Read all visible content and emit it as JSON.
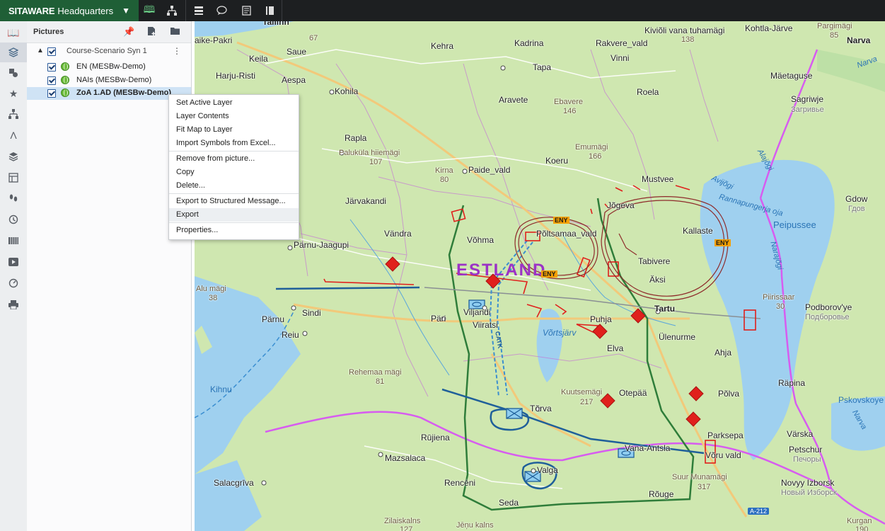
{
  "app": {
    "brand_bold": "SITAWARE",
    "brand_rest": "Headquarters",
    "dropdown": "⌄"
  },
  "panel": {
    "title": "Pictures",
    "picture": "Course-Scenario Syn 1",
    "layers": [
      {
        "label": "EN (MESBw-Demo)",
        "checked": true,
        "selected": false
      },
      {
        "label": "NAIs (MESBw-Demo)",
        "checked": true,
        "selected": false
      },
      {
        "label": "ZoA 1.AD (MESBw-Demo)",
        "checked": true,
        "selected": true
      }
    ]
  },
  "context_menu": {
    "groups": [
      [
        "Set Active Layer",
        "Layer Contents",
        "Fit Map to Layer",
        "Import Symbols from Excel..."
      ],
      [
        "Remove from picture...",
        "Copy",
        "Delete..."
      ],
      [
        "Export to Structured Message...",
        "Export"
      ],
      [
        "Properties..."
      ]
    ],
    "hovered": "Export"
  },
  "map": {
    "country": "ESTLAND",
    "places": [
      {
        "t": "Tallinn"
      },
      {
        "t": "Kiviõli vana tuhamägi"
      },
      {
        "t": "138"
      },
      {
        "t": "Kohtla-Järve"
      },
      {
        "t": "Pargimägi"
      },
      {
        "t": "85"
      },
      {
        "t": "Narva"
      },
      {
        "t": "aike-Pakri"
      },
      {
        "t": "67"
      },
      {
        "t": "Kehra"
      },
      {
        "t": "Kadrina"
      },
      {
        "t": "Rakvere_vald"
      },
      {
        "t": "Keila"
      },
      {
        "t": "Saue"
      },
      {
        "t": "Vinni"
      },
      {
        "t": "Harju-Risti"
      },
      {
        "t": "Tapa"
      },
      {
        "t": "Mäetaguse"
      },
      {
        "t": "Aespa"
      },
      {
        "t": "Kohila"
      },
      {
        "t": "Roela"
      },
      {
        "t": "Aravete"
      },
      {
        "t": "Ebavere"
      },
      {
        "t": "146"
      },
      {
        "t": "Sagriwje"
      },
      {
        "t": "Загривье"
      },
      {
        "t": "Rapla"
      },
      {
        "t": "Paluküla hiiemägi"
      },
      {
        "t": "107"
      },
      {
        "t": "Emumägi"
      },
      {
        "t": "166"
      },
      {
        "t": "Koeru"
      },
      {
        "t": "rjamaa"
      },
      {
        "t": "Kirna"
      },
      {
        "t": "80"
      },
      {
        "t": "Paide_vald"
      },
      {
        "t": "Mustvee"
      },
      {
        "t": "Järvakandi"
      },
      {
        "t": "Jõgeva"
      },
      {
        "t": "Gdow"
      },
      {
        "t": "Гдов"
      },
      {
        "t": "Vändra"
      },
      {
        "t": "Võhma"
      },
      {
        "t": "Põltsamaa_vald"
      },
      {
        "t": "Kallaste"
      },
      {
        "t": "Peipussee"
      },
      {
        "t": "Pärnu-Jaagupi"
      },
      {
        "t": "Tabivere"
      },
      {
        "t": "Äksi"
      },
      {
        "t": "Alu mägi"
      },
      {
        "t": "38"
      },
      {
        "t": "Piirissaar"
      },
      {
        "t": "30"
      },
      {
        "t": "Podborov'ye"
      },
      {
        "t": "Подборовье"
      },
      {
        "t": "Viljandi"
      },
      {
        "t": "Tartu"
      },
      {
        "t": "Pärnu"
      },
      {
        "t": "Sindi"
      },
      {
        "t": "Päri"
      },
      {
        "t": "Viiratsi"
      },
      {
        "t": "Puhja"
      },
      {
        "t": "Reiu"
      },
      {
        "t": "Võrtsjärv"
      },
      {
        "t": "Ülenurme"
      },
      {
        "t": "Elva"
      },
      {
        "t": "Ahja"
      },
      {
        "t": "Rehemaa mägi"
      },
      {
        "t": "81"
      },
      {
        "t": "Kihnu"
      },
      {
        "t": "Räpina"
      },
      {
        "t": "Kuutsemägi"
      },
      {
        "t": "217"
      },
      {
        "t": "Otepää"
      },
      {
        "t": "Põlva"
      },
      {
        "t": "Tõrva"
      },
      {
        "t": "Pskovskoye"
      },
      {
        "t": "Rūjiena"
      },
      {
        "t": "Parksepa"
      },
      {
        "t": "Värska"
      },
      {
        "t": "Mazsalaca"
      },
      {
        "t": "Vana-Antsla"
      },
      {
        "t": "Võru vald"
      },
      {
        "t": "Petschur"
      },
      {
        "t": "Печоры"
      },
      {
        "t": "Valga"
      },
      {
        "t": "Salacgrīva"
      },
      {
        "t": "Rencēni"
      },
      {
        "t": "Suur Munamägi"
      },
      {
        "t": "317"
      },
      {
        "t": "Novyy Izborsk"
      },
      {
        "t": "Новый Изборск"
      },
      {
        "t": "Rõuge"
      },
      {
        "t": "Seda"
      },
      {
        "t": "Zilaiskalns"
      },
      {
        "t": "127"
      },
      {
        "t": "Jēņu kalns"
      },
      {
        "t": "Kurgan"
      },
      {
        "t": "190"
      },
      {
        "t": "Alajõgi"
      },
      {
        "t": "Avijõgi"
      },
      {
        "t": "Rannapungerja oja"
      },
      {
        "t": "Narajõgi"
      },
      {
        "t": "Narva"
      },
      {
        "t": "Narva"
      }
    ],
    "eny_labels": [
      "ENY",
      "ENY",
      "ENY"
    ],
    "road_label": "A-212",
    "route_label": "CATK"
  }
}
